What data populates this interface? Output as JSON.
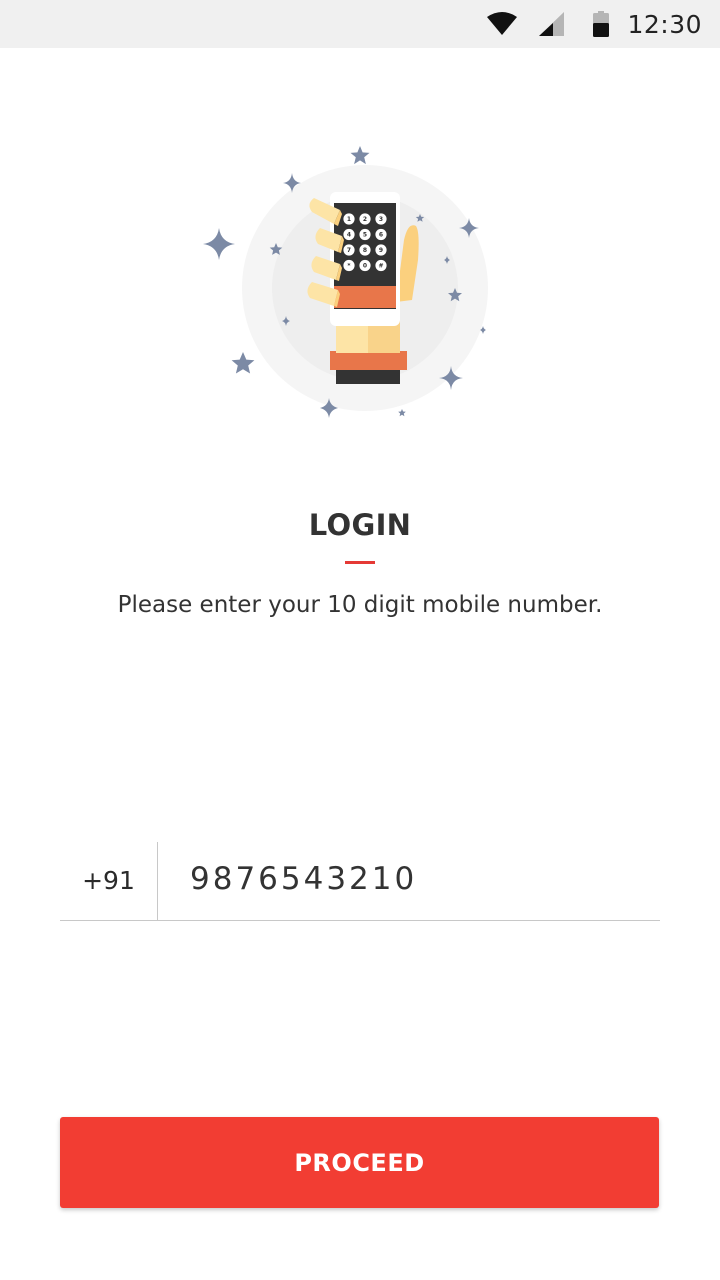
{
  "status_bar": {
    "time": "12:30",
    "icons": [
      "wifi-icon",
      "signal-icon",
      "battery-icon"
    ]
  },
  "illustration": {
    "name": "hand-holding-phone-illustration",
    "keypad_keys": [
      "1",
      "2",
      "3",
      "4",
      "5",
      "6",
      "7",
      "8",
      "9",
      "*",
      "0",
      "#"
    ]
  },
  "login": {
    "title": "LOGIN",
    "subtitle": "Please enter your 10 digit mobile number."
  },
  "phone": {
    "country_code": "+91",
    "value": "9876543210"
  },
  "proceed": {
    "label": "PROCEED"
  },
  "colors": {
    "accent": "#e53935",
    "button": "#f23d33",
    "status_bar_bg": "#f0f0f0",
    "star": "#7c8aa5",
    "phone_orange": "#e8764a",
    "skin": "#fde4a6"
  }
}
